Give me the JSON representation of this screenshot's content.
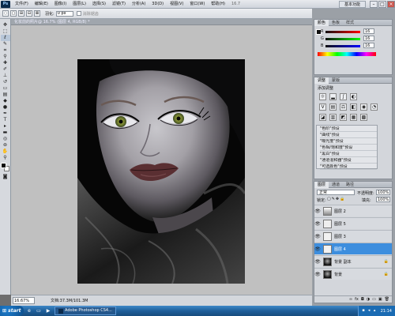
{
  "app": {
    "logo": "Ps",
    "menus": [
      "文件(F)",
      "编辑(E)",
      "图像(I)",
      "图层(L)",
      "选择(S)",
      "滤镜(T)",
      "分析(A)",
      "3D(D)",
      "视图(V)",
      "窗口(W)",
      "帮助(H)"
    ],
    "zoom_menu": "16.7",
    "workspace": "基本功能"
  },
  "options_bar": {
    "feather_label": "羽化:",
    "feather_value": "0 px",
    "antialias_label": "消除锯齿"
  },
  "document": {
    "tab_title": "化妆前的照片@ 16.7% (图层 4, RGB/8) *"
  },
  "status": {
    "zoom": "16.67%",
    "doc_info": "文档:37.3M/101.3M"
  },
  "color_panel": {
    "tabs": [
      "颜色",
      "色板",
      "样式"
    ],
    "channels": [
      {
        "label": "R",
        "value": "16",
        "color": "#d23b3b"
      },
      {
        "label": "G",
        "value": "16",
        "color": "#2f9a3b"
      },
      {
        "label": "B",
        "value": "16",
        "color": "#3351c8"
      }
    ]
  },
  "adjustments_panel": {
    "tabs": [
      "调整",
      "蒙版"
    ],
    "subtitle": "添加调整",
    "presets": [
      "\"色阶\"预设",
      "\"曲线\"预设",
      "\"曝光度\"预设",
      "\"色相/饱和度\"预设",
      "\"黑白\"预设",
      "\"通道混和器\"预设",
      "\"可选颜色\"预设"
    ]
  },
  "layers_panel": {
    "tabs": [
      "图层",
      "通道",
      "路径"
    ],
    "blend_mode": "正常",
    "opacity_label": "不透明度:",
    "opacity": "100%",
    "lock_label": "锁定:",
    "fill_label": "填充:",
    "fill": "100%",
    "layers": [
      {
        "name": "图层 2",
        "selected": false,
        "locked": false
      },
      {
        "name": "图层 5",
        "selected": false,
        "locked": false
      },
      {
        "name": "图层 3",
        "selected": false,
        "locked": false
      },
      {
        "name": "图层 4",
        "selected": true,
        "locked": false
      },
      {
        "name": "背景 副本",
        "selected": false,
        "locked": true
      },
      {
        "name": "背景",
        "selected": false,
        "locked": true
      }
    ]
  },
  "taskbar": {
    "start": "start",
    "task": "Adobe Photoshop CS4...",
    "clock": "21:14"
  },
  "colors": {
    "selected_layer": "#3d8ede",
    "taskbar": "#1f5f9a"
  }
}
